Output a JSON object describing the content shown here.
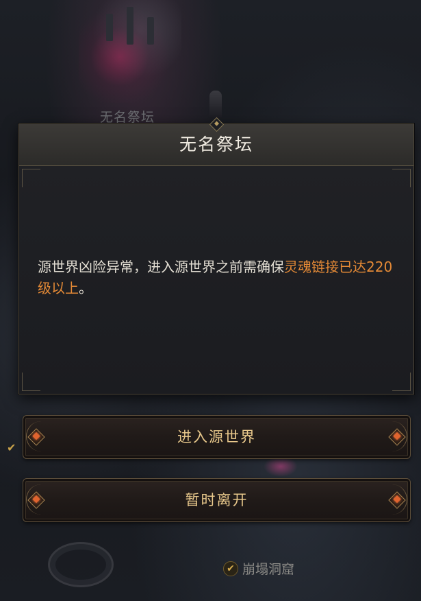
{
  "map": {
    "location_label": "无名祭坛",
    "bottom_location": "崩塌洞窟",
    "check_glyph": "✔"
  },
  "dialog": {
    "title": "无名祭坛",
    "message_before": "源世界凶险异常，进入源世界之前需确保",
    "message_highlight": "灵魂链接已达220级以上",
    "message_after": "。",
    "highlight_color": "#e58a36"
  },
  "buttons": {
    "enter": "进入源世界",
    "leave": "暂时离开"
  },
  "icons": {
    "header_ornament": "diamond-gem-icon",
    "button_ornament": "fire-gem-icon",
    "location_check": "checkmark-icon",
    "map_marker": "altar-marker-icon"
  }
}
